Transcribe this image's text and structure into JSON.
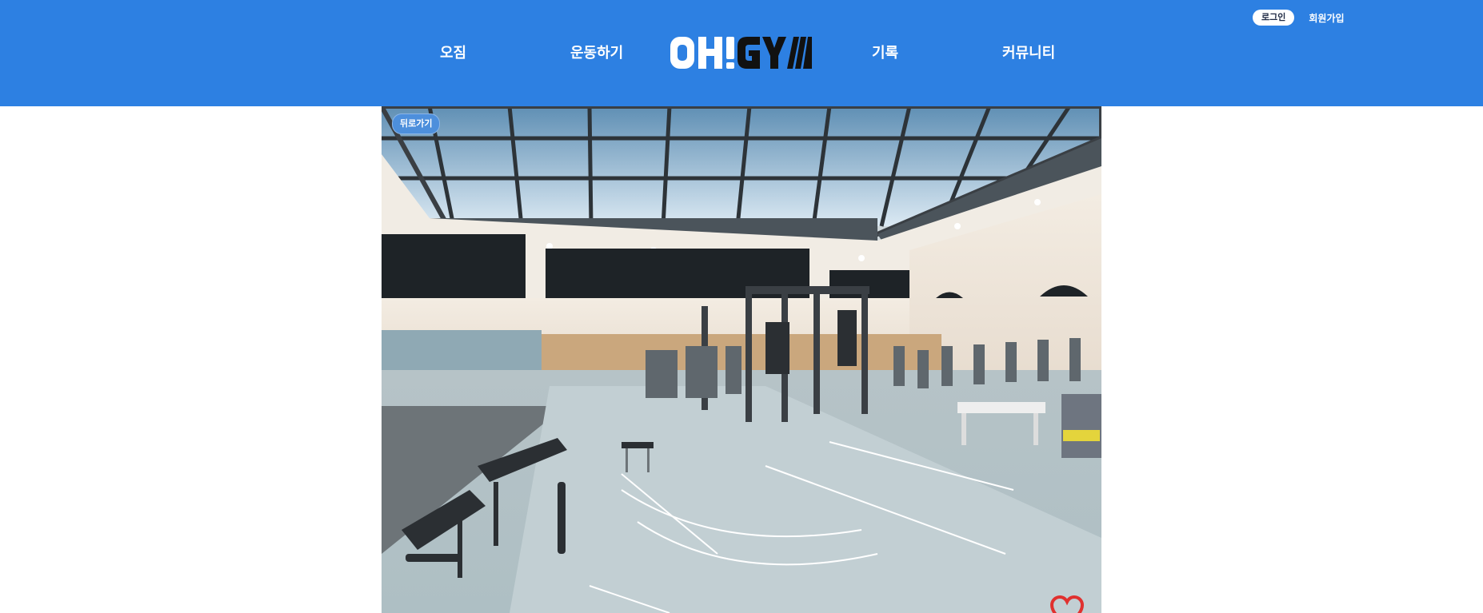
{
  "header": {
    "background_color": "#2d80e2",
    "logo": {
      "text": "OH!GYM",
      "icon": "ohgym-logo"
    },
    "nav": [
      {
        "label": "오짐"
      },
      {
        "label": "운동하기"
      },
      {
        "label": "기록"
      },
      {
        "label": "커뮤니티"
      }
    ],
    "auth": {
      "login_label": "로그인",
      "signup_label": "회원가입"
    }
  },
  "main": {
    "hero_image": {
      "icon": "gym-interior-photo"
    },
    "back_label": "뒤로가기",
    "favorite": {
      "icon": "heart-icon",
      "color": "#e0312f"
    }
  }
}
